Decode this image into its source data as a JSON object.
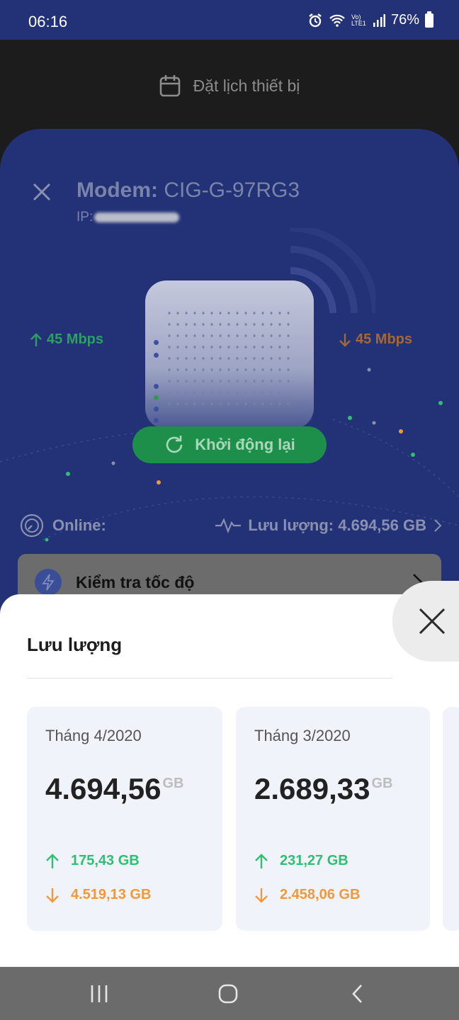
{
  "status_bar": {
    "time": "06:16",
    "battery": "76%",
    "network": "Vo) LTE1"
  },
  "schedule": {
    "label": "Đặt lịch thiết bị"
  },
  "modem": {
    "title_prefix": "Modem:",
    "name": "CIG-G-97RG3",
    "ip_label": "IP:",
    "upload_rate": "45 Mbps",
    "download_rate": "45 Mbps",
    "restart_label": "Khởi động lại",
    "status_label": "Online:",
    "traffic_label": "Lưu lượng: 4.694,56 GB"
  },
  "speed_test": {
    "label": "Kiểm tra tốc độ"
  },
  "sheet": {
    "title": "Lưu lượng",
    "cards": [
      {
        "month": "Tháng 4/2020",
        "total": "4.694,56",
        "unit": "GB",
        "upload": "175,43 GB",
        "download": "4.519,13 GB"
      },
      {
        "month": "Tháng 3/2020",
        "total": "2.689,33",
        "unit": "GB",
        "upload": "231,27 GB",
        "download": "2.458,06 GB"
      }
    ]
  },
  "colors": {
    "panel": "#233276",
    "upload": "#2fbf73",
    "download": "#f0993b",
    "restart": "#1e8f4b"
  }
}
